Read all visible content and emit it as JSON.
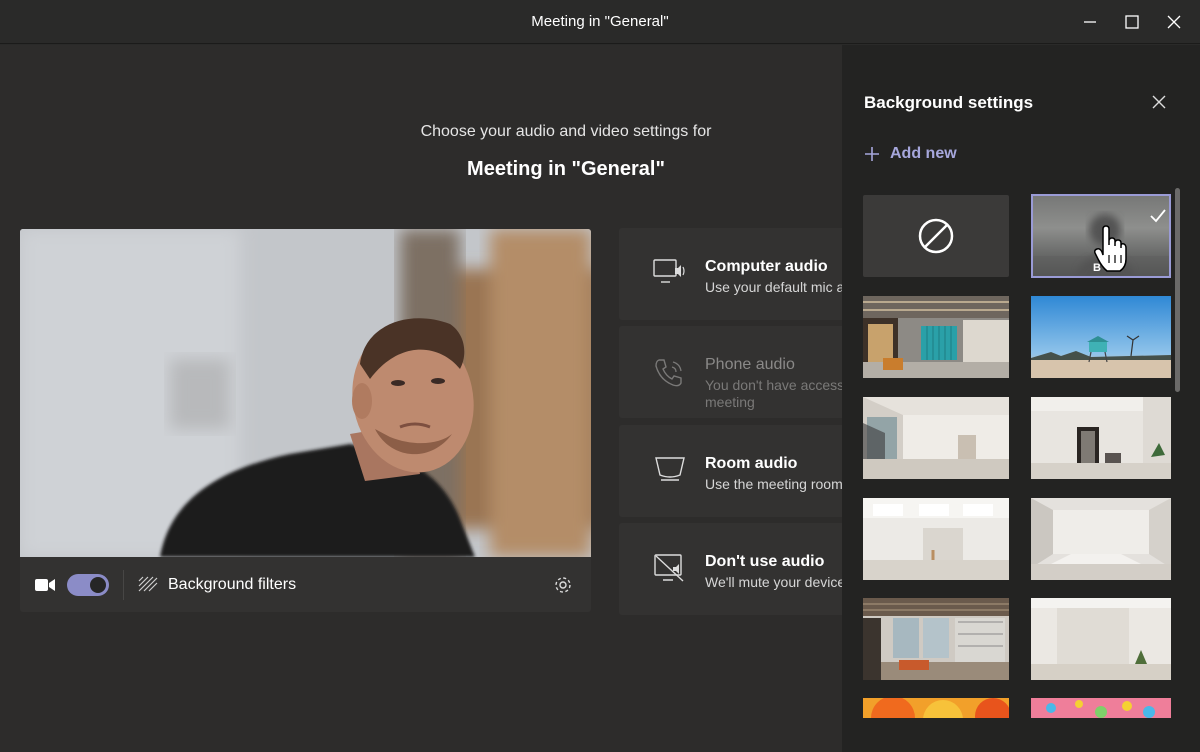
{
  "window": {
    "title": "Meeting in \"General\"",
    "minimize_icon": "minimize-icon",
    "maximize_icon": "maximize-icon",
    "close_icon": "close-icon"
  },
  "prejoin": {
    "prompt": "Choose your audio and video settings for",
    "meeting_title": "Meeting in \"General\""
  },
  "video": {
    "camera_on": true,
    "background_filters_label": "Background filters",
    "icons": [
      "video-camera-icon",
      "background-filters-icon",
      "settings-gear-icon"
    ]
  },
  "audio_options": [
    {
      "label": "Computer audio",
      "description": "Use your default mic and speakers",
      "icon": "computer-audio-icon",
      "enabled": true
    },
    {
      "label": "Phone audio",
      "description": "You don't have access to phone audio for this",
      "description2": "meeting",
      "icon": "phone-audio-icon",
      "enabled": false
    },
    {
      "label": "Room audio",
      "description": "Use the meeting room's audio",
      "icon": "room-audio-icon",
      "enabled": true
    },
    {
      "label": "Don't use audio",
      "description": "We'll mute your device",
      "icon": "no-audio-icon",
      "enabled": true
    }
  ],
  "background_panel": {
    "title": "Background settings",
    "add_new_label": "Add new",
    "selected": "blur",
    "options": [
      {
        "name": "none",
        "icon": "no-background-icon"
      },
      {
        "name": "blur",
        "label": "B",
        "icon": "checkmark-icon"
      },
      {
        "name": "office-lockers"
      },
      {
        "name": "beach-lifeguard-tower"
      },
      {
        "name": "white-room-window"
      },
      {
        "name": "white-room-mirror"
      },
      {
        "name": "white-loft"
      },
      {
        "name": "white-studio"
      },
      {
        "name": "industrial-loft"
      },
      {
        "name": "white-wall-room"
      },
      {
        "name": "orange-spheres"
      },
      {
        "name": "colorful-balls"
      }
    ]
  },
  "cursor": "hand-pointer-icon"
}
